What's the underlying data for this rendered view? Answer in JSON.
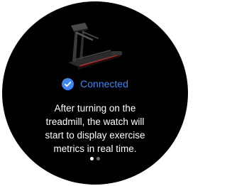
{
  "status": {
    "label": "Connected",
    "icon": "check-circle-icon",
    "color": "#3f86f0"
  },
  "message": {
    "lines": [
      "After turning on the",
      "treadmill, the watch will",
      "start to display exercise",
      "metrics in real time."
    ]
  },
  "illustration": {
    "icon": "treadmill-icon",
    "accent_color": "#c8242b"
  },
  "pager": {
    "page_count": 2,
    "current_page": 1
  }
}
